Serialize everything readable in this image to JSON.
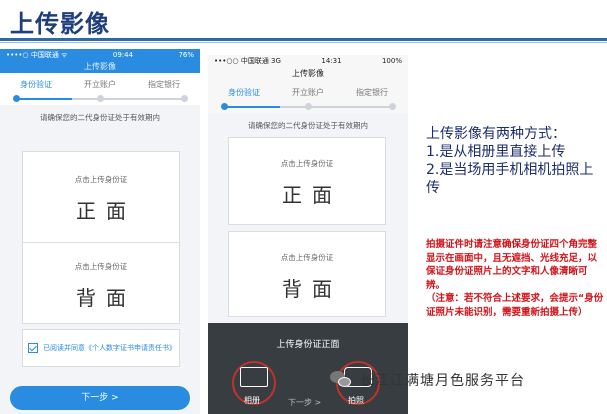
{
  "slide": {
    "title": "上传影像",
    "methods": [
      "上传影像有两种方式：",
      "1.是从相册里直接上传",
      "2.是当场用手机相机拍照上传"
    ],
    "notice": [
      "拍摄证件时请注意确保身份证四个角完整显示在画面中，且无遮挡、光线充足，以保证身份证照片上的文字和人像清晰可辨。",
      "（注意：若不符合上述要求，会提示“身份证照片未能识别，需要重新拍摄上传）"
    ],
    "watermark": "长江江满塘月色服务平台"
  },
  "phone1": {
    "status": {
      "carrier": "••••○ 中国联通 ᯤ",
      "time": "09:44",
      "battery": "76%"
    },
    "nav_title": "上传影像",
    "steps": [
      "身份验证",
      "开立账户",
      "指定银行"
    ],
    "hint": "请确保您的二代身份证处于有效期内",
    "front": {
      "upload": "点击上传身份证",
      "side": "正面"
    },
    "back": {
      "upload": "点击上传身份证",
      "side": "背面"
    },
    "agree_text": "已阅读并同意《个人数字证书申请责任书》",
    "next": "下一步 >"
  },
  "phone2": {
    "status": {
      "carrier": "•••○○ 中国联通  3G",
      "time": "14:31",
      "battery": "100%"
    },
    "nav_title": "上传影像",
    "steps": [
      "身份验证",
      "开立账户",
      "指定银行"
    ],
    "hint": "请确保您的二代身份证处于有效期内",
    "front": {
      "upload": "点击上传身份证",
      "side": "正面"
    },
    "back": {
      "upload": "点击上传身份证",
      "side": "背面"
    },
    "sheet_title": "上传身份证正面",
    "album": "相册",
    "camera": "拍照",
    "next": "下一步 >"
  },
  "colors": {
    "accent": "#2a8ce0",
    "title": "#1f3f7a",
    "notice": "#d0141a"
  }
}
